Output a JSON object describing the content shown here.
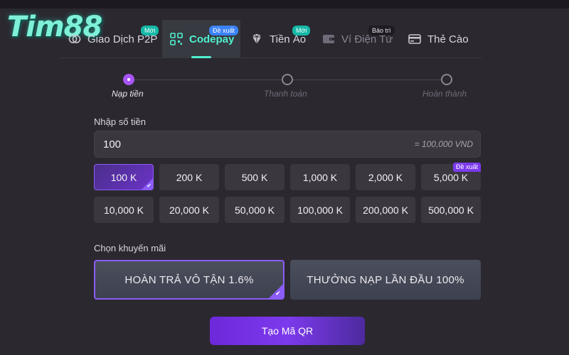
{
  "logo": {
    "text": "Tim88"
  },
  "tabs": [
    {
      "label": "Giao Dịch P2P",
      "badge": "Mới",
      "icon": "p2p-coins-icon",
      "active": false
    },
    {
      "label": "Codepay",
      "badge": "Đề xuất",
      "icon": "qr-code-icon",
      "active": true
    },
    {
      "label": "Tiền Ảo",
      "badge": "Mới",
      "icon": "crypto-gem-icon",
      "active": false
    },
    {
      "label": "Ví Điện Tử",
      "badge": "Bảo trì",
      "icon": "wallet-icon",
      "active": false,
      "disabled": true
    },
    {
      "label": "Thẻ Cào",
      "badge": "",
      "icon": "card-icon",
      "active": false
    }
  ],
  "steps": [
    {
      "label": "Nạp tiền",
      "active": true
    },
    {
      "label": "Thanh toán",
      "active": false
    },
    {
      "label": "Hoàn thành",
      "active": false
    }
  ],
  "amount": {
    "label": "Nhập số tiền",
    "value": "100",
    "converted": "= 100,000 VND"
  },
  "quick_amounts": [
    {
      "label": "100 K",
      "selected": true,
      "tag": ""
    },
    {
      "label": "200 K",
      "selected": false,
      "tag": ""
    },
    {
      "label": "500 K",
      "selected": false,
      "tag": ""
    },
    {
      "label": "1,000 K",
      "selected": false,
      "tag": ""
    },
    {
      "label": "2,000 K",
      "selected": false,
      "tag": ""
    },
    {
      "label": "5,000 K",
      "selected": false,
      "tag": "Đề xuất"
    },
    {
      "label": "10,000 K",
      "selected": false,
      "tag": ""
    },
    {
      "label": "20,000 K",
      "selected": false,
      "tag": ""
    },
    {
      "label": "50,000 K",
      "selected": false,
      "tag": ""
    },
    {
      "label": "100,000 K",
      "selected": false,
      "tag": ""
    },
    {
      "label": "200,000 K",
      "selected": false,
      "tag": ""
    },
    {
      "label": "500,000 K",
      "selected": false,
      "tag": ""
    }
  ],
  "promo": {
    "label": "Chọn khuyến mãi",
    "options": [
      {
        "label": "HOÀN TRẢ VÔ TẬN 1.6%",
        "selected": true
      },
      {
        "label": "THƯỞNG NẠP LẦN ĐẦU 100%",
        "selected": false
      }
    ]
  },
  "cta": {
    "label": "Tạo Mã QR"
  },
  "colors": {
    "accent_teal": "#4ff0d0",
    "accent_purple": "#8b5cf6",
    "background": "#2b2830"
  }
}
